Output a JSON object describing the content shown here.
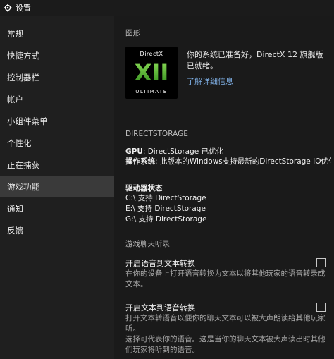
{
  "window": {
    "title": "设置"
  },
  "sidebar": {
    "items": [
      {
        "label": "常规"
      },
      {
        "label": "快捷方式"
      },
      {
        "label": "控制器栏"
      },
      {
        "label": "帐户"
      },
      {
        "label": "小组件菜单"
      },
      {
        "label": "个性化"
      },
      {
        "label": "正在捕获"
      },
      {
        "label": "游戏功能"
      },
      {
        "label": "通知"
      },
      {
        "label": "反馈"
      }
    ],
    "active_index": 7
  },
  "graphics": {
    "section_title": "图形",
    "logo": {
      "top_text": "DirectX",
      "mark_text": "XII",
      "bottom_text": "ULTIMATE"
    },
    "ready_text": "你的系统已准备好，DirectX 12 旗舰版已就绪。",
    "learn_more": "了解详细信息"
  },
  "directstorage": {
    "section_title": "DIRECTSTORAGE",
    "gpu_label": "GPU",
    "gpu_value": ": DirectStorage 已优化",
    "os_label": "操作系统",
    "os_value": ": 此版本的Windows支持最新的DirectStorage IO优化",
    "drive_status_title": "驱动器状态",
    "drives": [
      "C:\\ 支持 DirectStorage",
      "E:\\ 支持 DirectStorage",
      "G:\\ 支持 DirectStorage"
    ]
  },
  "game_chat": {
    "section_title": "游戏聊天听录",
    "options": [
      {
        "title": "开启语音到文本转换",
        "description": "在你的设备上打开语音转换为文本以将其他玩家的语音转录成文本。",
        "checked": false
      },
      {
        "title": "开启文本到语音转换",
        "description": "打开文本转语音以便你的聊天文本可以被大声朗读给其他玩家听。",
        "description2": "选择可代表你的语音。这是当你的聊天文本被大声读出时其他们玩家将听到的语音。",
        "checked": false
      }
    ]
  },
  "colors": {
    "accent_link": "#7fb0e6",
    "active_nav": "#3a3a3a",
    "logo_green": "#4caf2c"
  }
}
